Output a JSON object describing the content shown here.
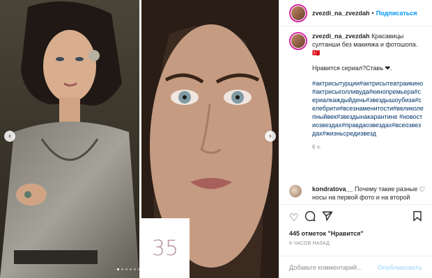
{
  "media": {
    "carousel_dots": 6,
    "active_dot": 0,
    "overlay_number": "35"
  },
  "header": {
    "username": "zvezdi_na_zvezdah",
    "separator": "•",
    "follow_label": "Подписаться"
  },
  "caption": {
    "username": "zvezdi_na_zvezdah",
    "line1": "Красавицы султанши без макияжа и фотошопа. 🇹🇷",
    "line2": "Нравится сериал?Ставь ❤.",
    "hashtags": "#актрисытурции#актрисытеатраикино#актрисыголливуда#кинопремьера#сериалкаждыйдень#звездышоубиза#селебрити#всезнаменитости#великолепныйвек#звездынакарантине #новостиозвездах#правдаозвездах#всеозвездах#жизньсредизвезд",
    "time": "6 ч."
  },
  "comment": {
    "username": "kondratova__",
    "text": "Почему такие разные носы на первой фото и на второй"
  },
  "actions": {
    "likes": "445 отметок \"Нравится\"",
    "posted": "6 ЧАСОВ НАЗАД"
  },
  "add_comment": {
    "placeholder": "Добавьте комментарий...",
    "publish_label": "Опубликовать"
  },
  "colors": {
    "link_blue": "#0095f6",
    "hashtag": "#00376b",
    "muted": "#8e8e8e",
    "publish_disabled": "#b2dffc",
    "badge_number": "#b5909a"
  },
  "icons": [
    "heart-icon",
    "comment-icon",
    "share-icon",
    "bookmark-icon",
    "chevron-left-icon",
    "chevron-right-icon"
  ]
}
